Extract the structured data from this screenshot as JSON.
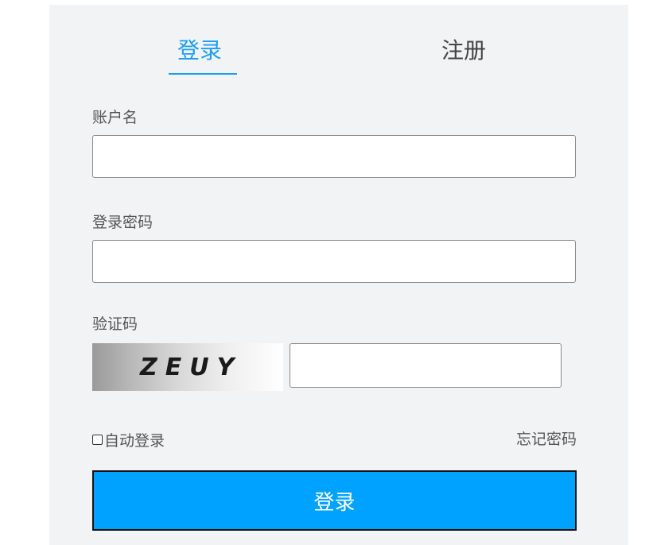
{
  "tabs": {
    "login": "登录",
    "register": "注册"
  },
  "form": {
    "username_label": "账户名",
    "username_value": "",
    "password_label": "登录密码",
    "password_value": "",
    "captcha_label": "验证码",
    "captcha_text": "ZEUY",
    "captcha_value": "",
    "remember_label": "自动登录",
    "remember_checked": false,
    "forgot_label": "忘记密码",
    "submit_label": "登录"
  },
  "colors": {
    "accent": "#1b9ef3",
    "submit_bg": "#00a2ff",
    "panel_bg": "#f2f3f5"
  }
}
